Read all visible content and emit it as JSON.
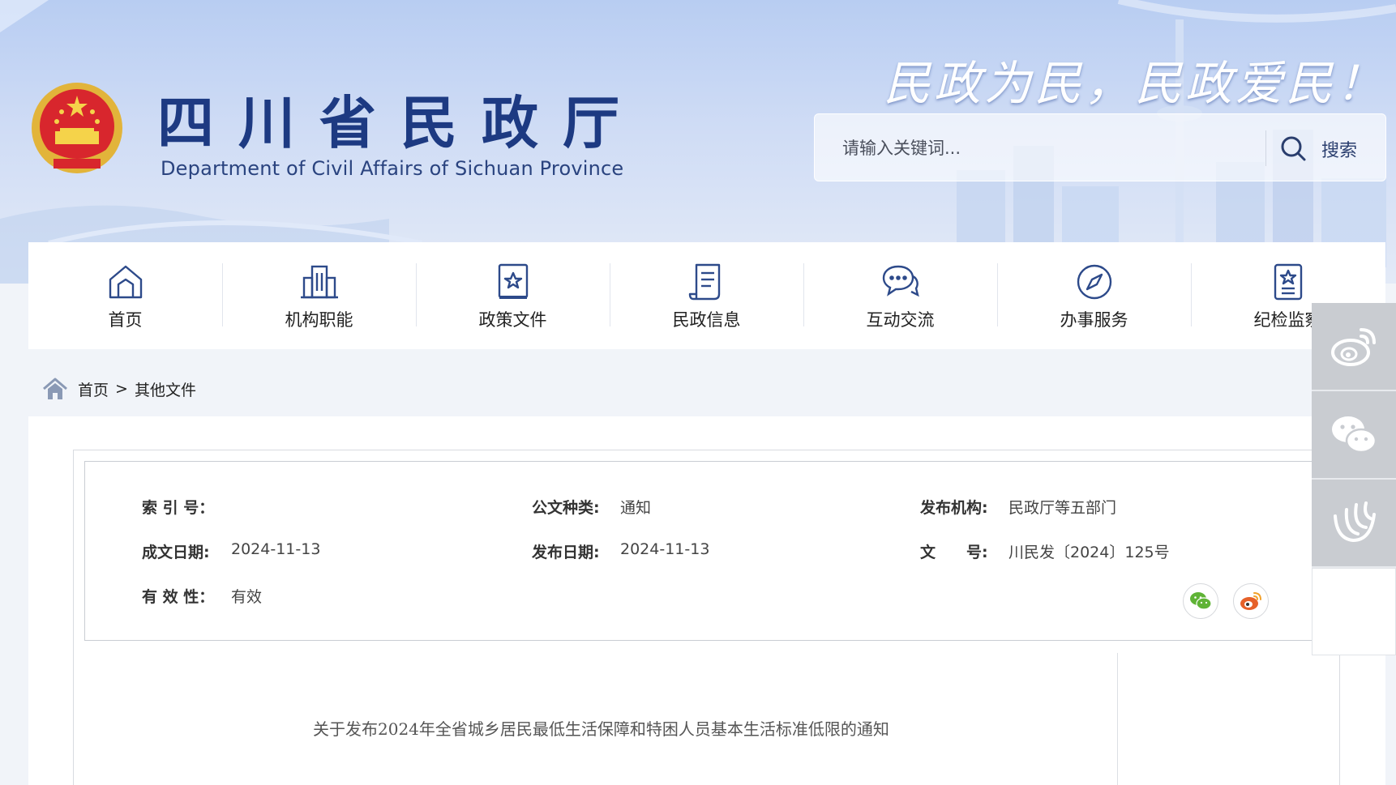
{
  "header": {
    "title": "四川省民政厅",
    "subtitle": "Department of Civil Affairs of Sichuan Province",
    "slogan": "民政为民，民政爱民！",
    "emblem_icon": "national-emblem-icon"
  },
  "search": {
    "placeholder": "请输入关键词...",
    "button_label": "搜索"
  },
  "nav": {
    "items": [
      {
        "label": "首页",
        "icon": "home-icon"
      },
      {
        "label": "机构职能",
        "icon": "building-icon"
      },
      {
        "label": "政策文件",
        "icon": "policy-doc-icon"
      },
      {
        "label": "民政信息",
        "icon": "scroll-icon"
      },
      {
        "label": "互动交流",
        "icon": "chat-bubbles-icon"
      },
      {
        "label": "办事服务",
        "icon": "compass-icon"
      },
      {
        "label": "纪检监察",
        "icon": "badge-icon"
      }
    ]
  },
  "side_float": {
    "items": [
      "weibo-icon",
      "wechat-icon",
      "app-icon"
    ]
  },
  "breadcrumb": {
    "home": "首页",
    "separator": ">",
    "current": "其他文件"
  },
  "meta": {
    "index_label": "索 引 号：",
    "index_value": "",
    "doc_type_label": "公文种类:",
    "doc_type_value": "通知",
    "publisher_label": "发布机构:",
    "publisher_value": "民政厅等五部门",
    "created_label": "成文日期:",
    "created_value": "2024-11-13",
    "published_label": "发布日期:",
    "published_value": "2024-11-13",
    "doc_no_label": "文　　号:",
    "doc_no_value": "川民发〔2024〕125号",
    "validity_label": "有 效 性：",
    "validity_value": "有效"
  },
  "share": [
    "wechat-icon",
    "weibo-icon"
  ],
  "colors": {
    "brand_navy": "#1d3a82",
    "wechat_green": "#5fb336",
    "weibo_orange": "#e6612a",
    "side_gray": "#c9ccd1"
  },
  "document": {
    "title": "关于发布2024年全省城乡居民最低生活保障和特困人员基本生活标准低限的通知"
  }
}
